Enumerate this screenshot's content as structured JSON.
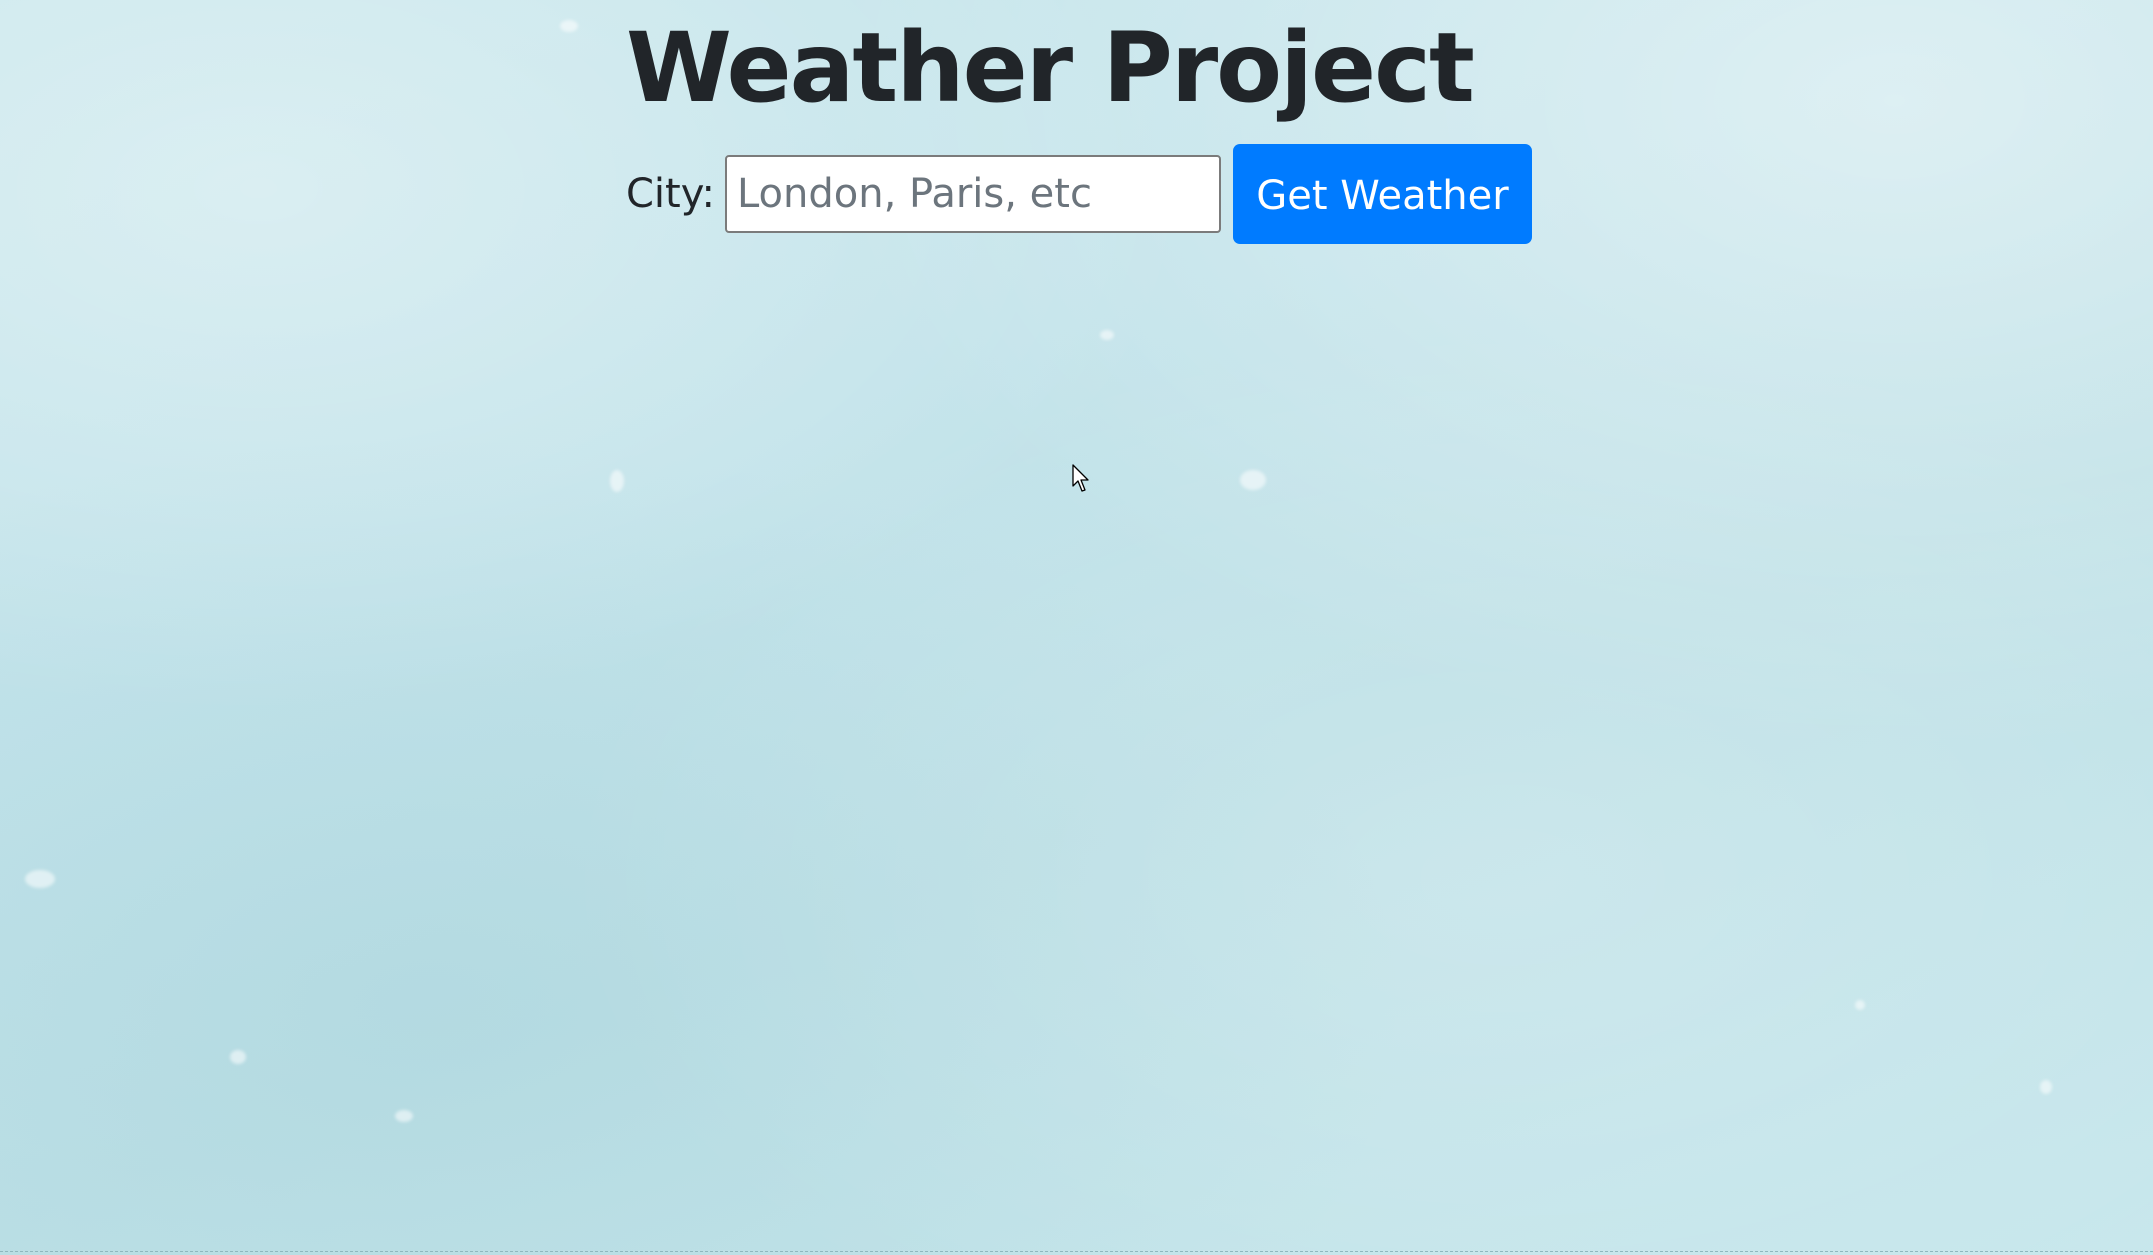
{
  "page": {
    "title": "Weather Project",
    "background_color": "#c2e3ea"
  },
  "form": {
    "city_label": "City:",
    "city_input_value": "",
    "city_input_placeholder": "London, Paris, etc",
    "submit_label": "Get Weather",
    "submit_color": "#007bff"
  },
  "cursor": {
    "icon": "arrow-pointer-icon"
  }
}
